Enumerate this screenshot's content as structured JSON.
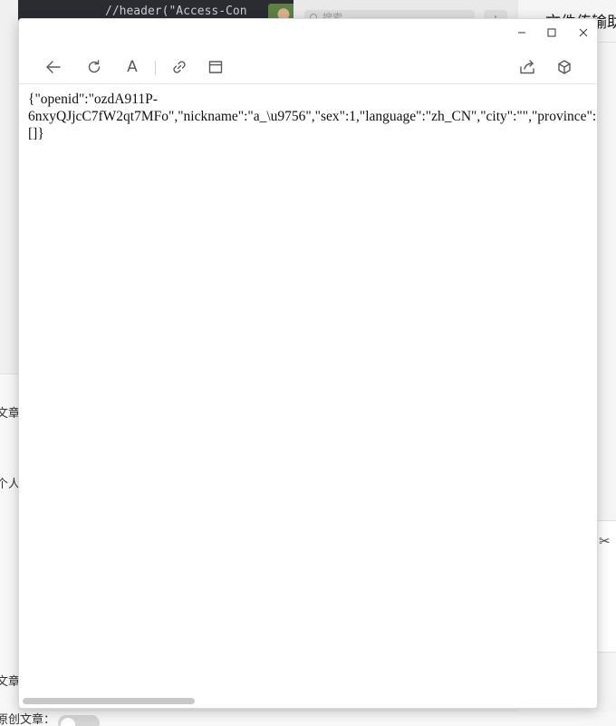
{
  "background": {
    "code_line": "//header(\"Access-Con",
    "search_placeholder": "搜索",
    "plus_label": "+",
    "right_panel_title": "文件传输助手",
    "left_labels": [
      "文章标",
      "个人发",
      "文章类",
      "原创文章："
    ],
    "scissors_icon": "scissors-icon"
  },
  "window": {
    "buttons": {
      "minimize": "minimize-icon",
      "maximize": "maximize-icon",
      "close": "close-icon"
    },
    "toolbar": {
      "back": "back-arrow-icon",
      "refresh": "refresh-icon",
      "font": "A",
      "link": "link-icon",
      "layout": "window-icon",
      "share": "share-icon",
      "extension": "cube-icon"
    },
    "content": {
      "lines": [
        "{\"openid\":\"ozdA911P-",
        "6nxyQJjcC7fW2qt7MFo\",\"nickname\":\"a_\\u9756\",\"sex\":1,\"language\":\"zh_CN\",\"city\":\"\",\"province\":\"\",\"country\":\"\",\"headimgurl\":\"\",\"privilege\":",
        "[]}"
      ]
    }
  },
  "colors": {
    "window_bg": "#ffffff",
    "icon": "#5a5a5a",
    "code_bg": "#2a2c31"
  }
}
